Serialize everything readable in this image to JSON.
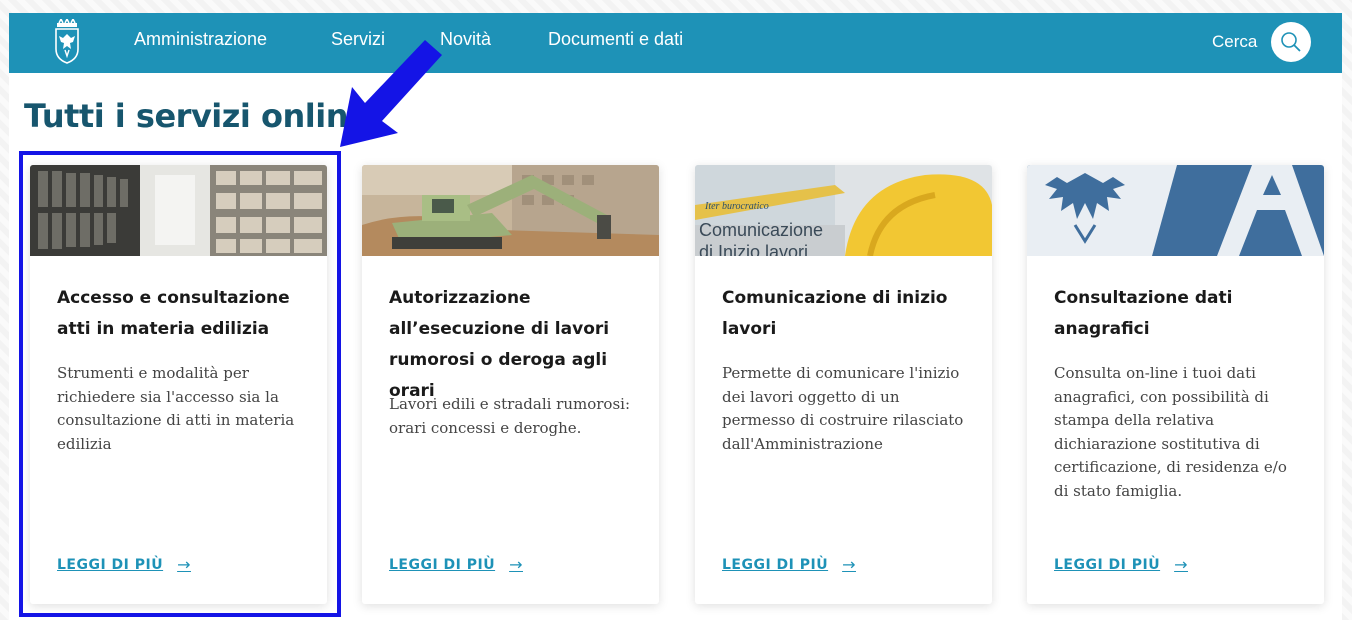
{
  "nav": {
    "items": [
      {
        "label": "Amministrazione"
      },
      {
        "label": "Servizi"
      },
      {
        "label": "Novità"
      },
      {
        "label": "Documenti e dati"
      }
    ],
    "search_label": "Cerca"
  },
  "page_title": "Tutti i servizi online",
  "cards": [
    {
      "title": "Accesso e consultazione atti in materia edilizia",
      "description": "Strumenti e modalità per richiedere sia l'accesso sia la consultazione di atti in materia edilizia",
      "link": "LEGGI DI PIÙ",
      "image": "archive-shelves"
    },
    {
      "title": "Autorizzazione all’esecuzione di lavori rumorosi o deroga agli orari",
      "description": "Lavori edili e stradali rumorosi: orari concessi e deroghe.",
      "link": "LEGGI DI PIÙ",
      "image": "excavator"
    },
    {
      "title": "Comunicazione di inizio lavori",
      "description": "Permette di comunicare l'inizio dei lavori oggetto di un permesso di costruire rilasciato dall'Amministrazione",
      "link": "LEGGI DI PIÙ",
      "image": "hard-hat",
      "image_text_1": "Iter burocratico",
      "image_text_2": "Comunicazione",
      "image_text_3": "di Inizio lavori"
    },
    {
      "title": "Consultazione dati anagrafici",
      "description": "Consulta on-line i tuoi dati anagrafici, con possibilità di stampa della relativa dichiarazione sostitutiva di certificazione, di residenza e/o di stato famiglia.",
      "link": "LEGGI DI PIÙ",
      "image": "eagle-crest"
    }
  ],
  "colors": {
    "navbar": "#1e92b7",
    "title": "#17566e",
    "link": "#1e92b7",
    "highlight": "#1414e6"
  }
}
